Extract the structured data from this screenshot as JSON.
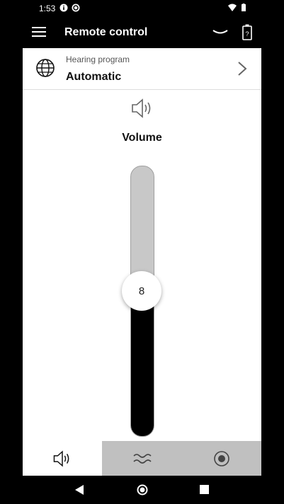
{
  "status_bar": {
    "time": "1:53"
  },
  "app_bar": {
    "title": "Remote control"
  },
  "program": {
    "label": "Hearing program",
    "value": "Automatic"
  },
  "volume": {
    "title": "Volume",
    "value": "8",
    "level_percent": 48
  },
  "tabs": [
    {
      "name": "volume",
      "active": true
    },
    {
      "name": "sound-wave",
      "active": false
    },
    {
      "name": "target",
      "active": false
    }
  ],
  "colors": {
    "background": "#000000",
    "surface": "#ffffff",
    "slider_track": "#c8c8c8",
    "slider_fill": "#000000",
    "tab_inactive": "#c0c0c0"
  }
}
